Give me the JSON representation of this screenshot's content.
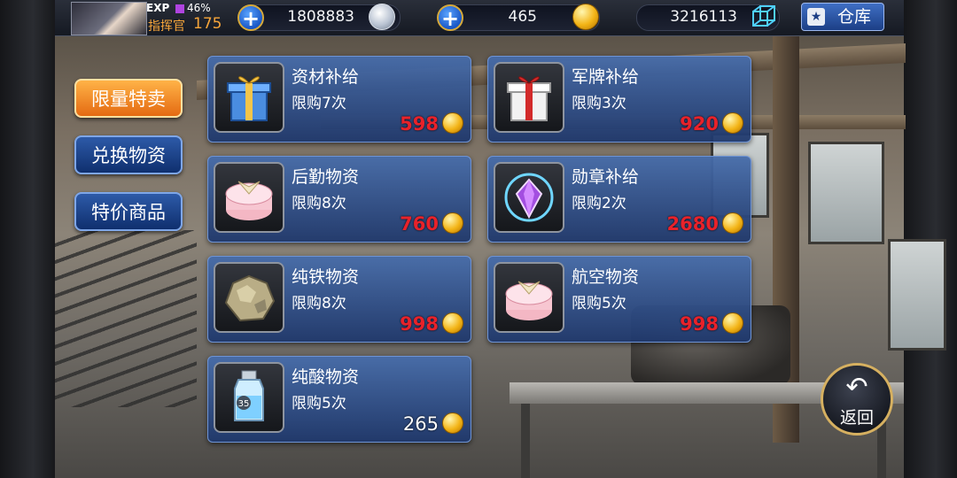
{
  "topbar": {
    "exp_label": "EXP",
    "exp_percent": "46%",
    "commander_label": "指挥官",
    "commander_level": "175",
    "silver": "1808883",
    "gold": "465",
    "crystal": "3216113",
    "storage_label": "仓库",
    "storage_icon_glyph": "★"
  },
  "tabs": [
    {
      "label": "限量特卖",
      "active": true
    },
    {
      "label": "兑换物资",
      "active": false
    },
    {
      "label": "特价商品",
      "active": false
    }
  ],
  "items": [
    {
      "name": "资材补给",
      "limit": "限购7次",
      "price": "598",
      "icon": "blue-gift-box-icon"
    },
    {
      "name": "军牌补给",
      "limit": "限购3次",
      "price": "920",
      "icon": "red-gift-box-icon"
    },
    {
      "name": "后勤物资",
      "limit": "限购8次",
      "price": "760",
      "icon": "pink-cake-box-icon"
    },
    {
      "name": "勋章补给",
      "limit": "限购2次",
      "price": "2680",
      "icon": "purple-medal-icon"
    },
    {
      "name": "纯铁物资",
      "limit": "限购8次",
      "price": "998",
      "icon": "iron-ore-icon"
    },
    {
      "name": "航空物资",
      "limit": "限购5次",
      "price": "998",
      "icon": "pink-cake-box-icon"
    },
    {
      "name": "纯酸物资",
      "limit": "限购5次",
      "price": "265",
      "icon": "acid-bottle-icon",
      "bottle_label": "35"
    }
  ],
  "back": {
    "label": "返回",
    "glyph": "↶"
  },
  "colors": {
    "price_red": "#e8222a",
    "tab_active": "#f08a24",
    "tab_inactive": "#1f4a94",
    "card": "#34578f"
  }
}
